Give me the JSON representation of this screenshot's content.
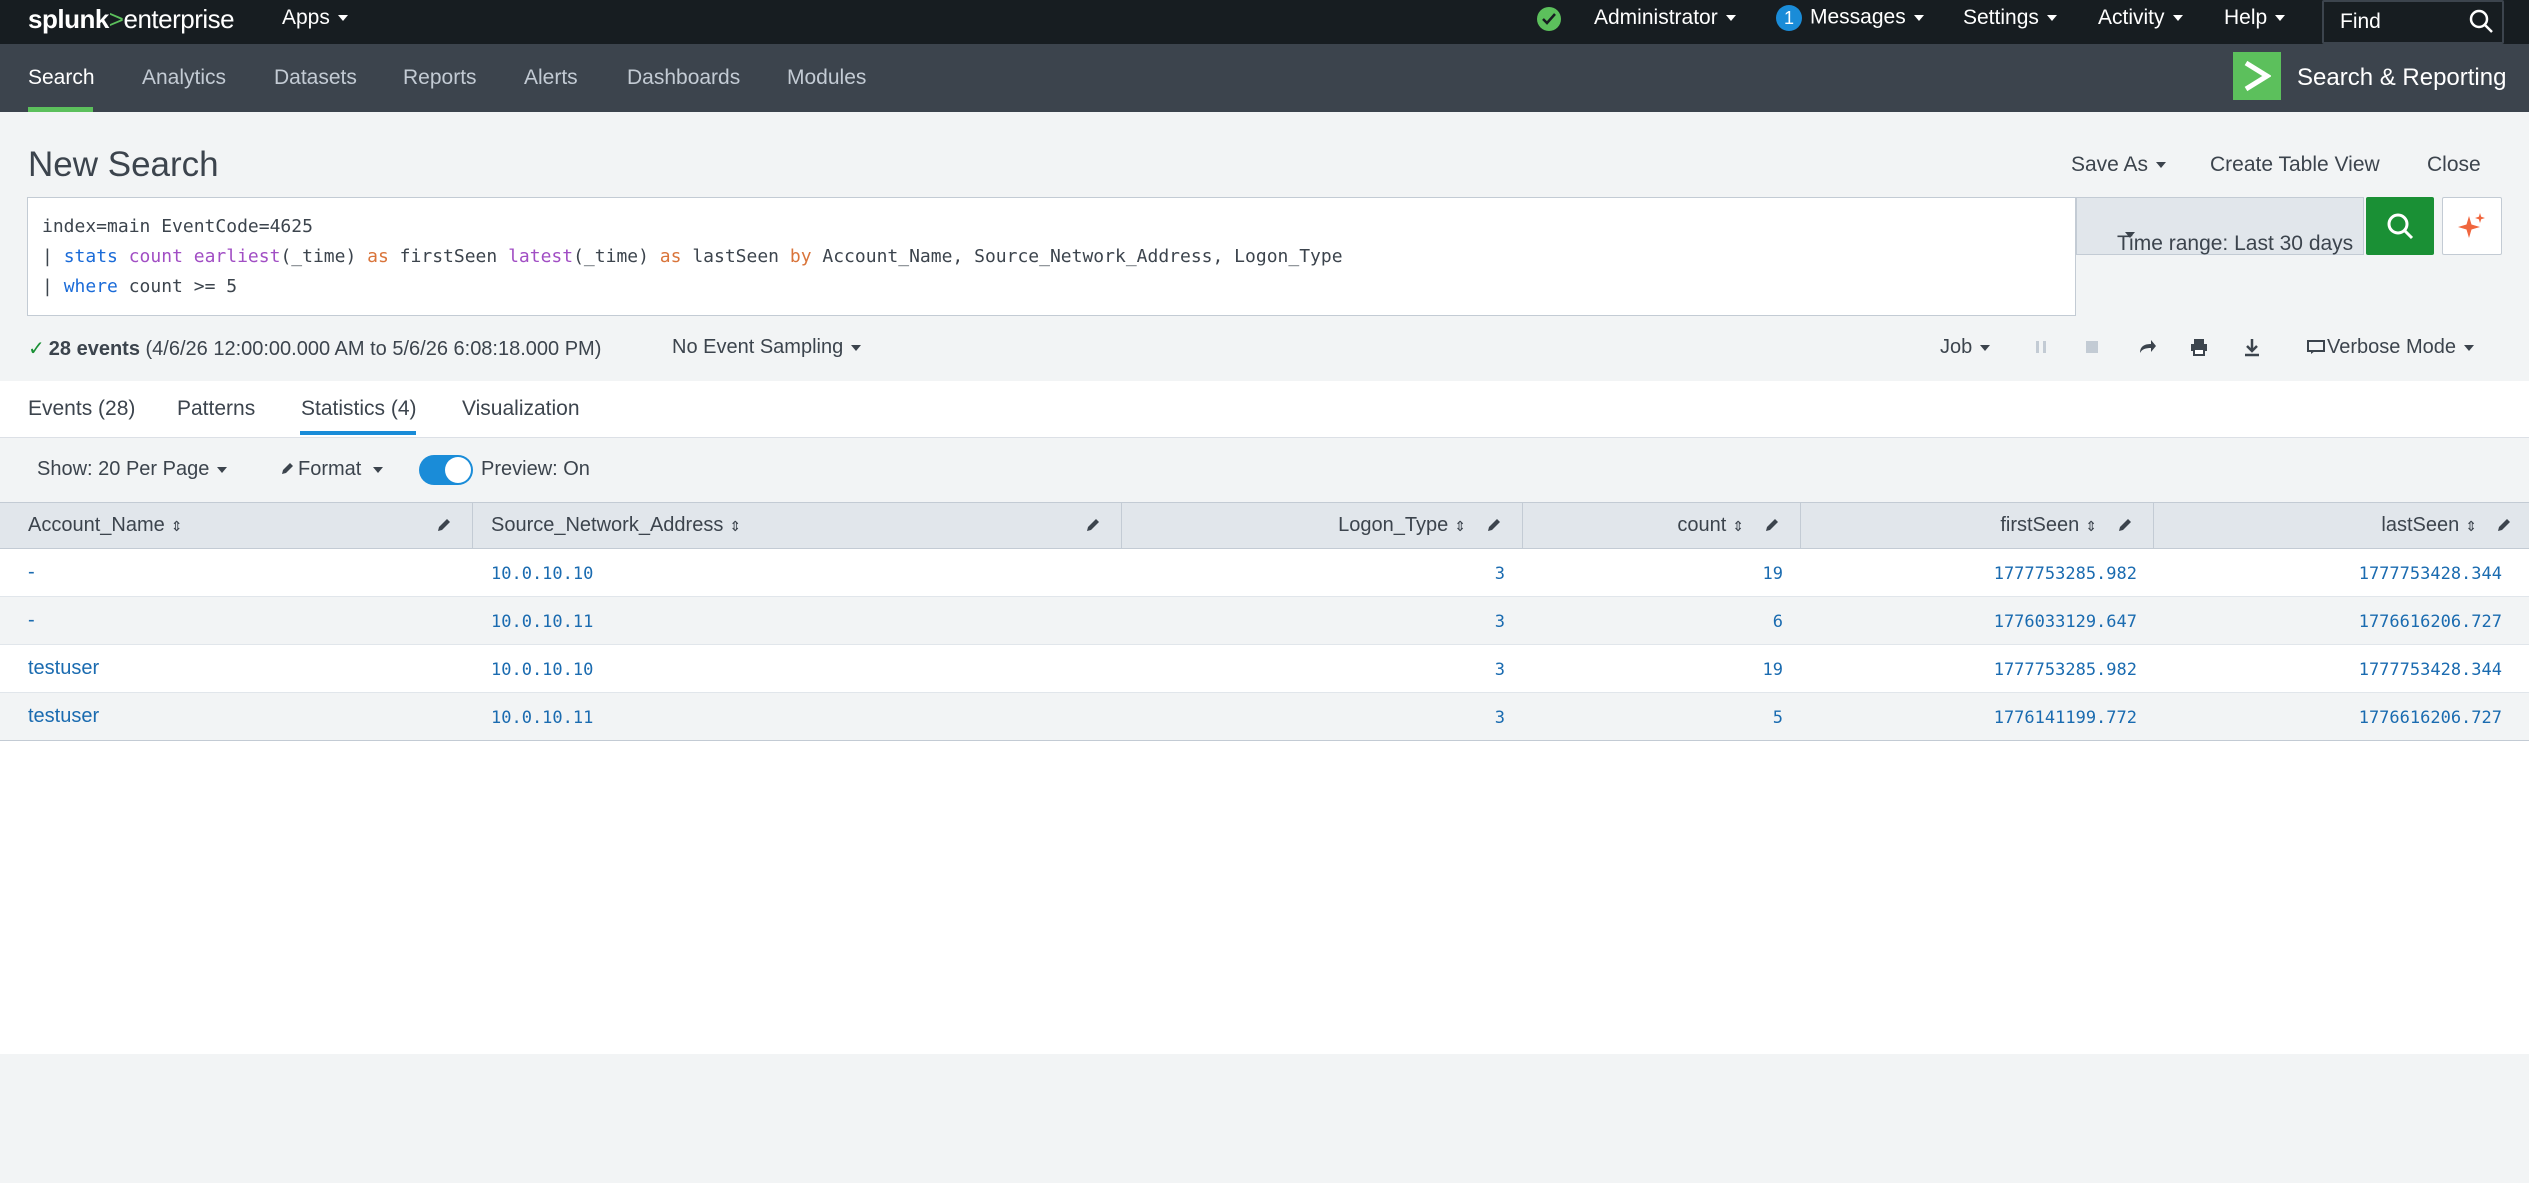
{
  "topbar": {
    "brand_main": "splunk",
    "brand_arrow": ">",
    "brand_sub": "enterprise",
    "apps_label": "Apps",
    "user_label": "Administrator",
    "messages_count": "1",
    "messages_label": "Messages",
    "settings_label": "Settings",
    "activity_label": "Activity",
    "help_label": "Help",
    "find_placeholder": "Find"
  },
  "appbar": {
    "nav": [
      "Search",
      "Analytics",
      "Datasets",
      "Reports",
      "Alerts",
      "Dashboards",
      "Modules"
    ],
    "active": "Search",
    "app_name": "Search & Reporting"
  },
  "title": {
    "page_title": "New Search",
    "save_as": "Save As",
    "create_table_view": "Create Table View",
    "close": "Close"
  },
  "search": {
    "line1": "index=main EventCode=4625",
    "line2": {
      "pipe": "| ",
      "cmd": "stats",
      "fn1": "count",
      "fn2": "earliest",
      "arg2": "(_time) ",
      "as1": "as",
      "name1": " firstSeen ",
      "fn3": "latest",
      "arg3": "(_time) ",
      "as2": "as",
      "name2": " lastSeen ",
      "by": "by",
      "fields": " Account_Name, Source_Network_Address, Logon_Type"
    },
    "line3": {
      "pipe": "| ",
      "cmd": "where",
      "rest": " count >= 5"
    },
    "time_range": "Time range: Last 30 days"
  },
  "status": {
    "events": "28 events",
    "range": "(4/6/26 12:00:00.000 AM to 5/6/26 6:08:18.000 PM)",
    "sampling": "No Event Sampling",
    "job": "Job",
    "mode": "Verbose Mode"
  },
  "tabs": [
    "Events (28)",
    "Patterns",
    "Statistics (4)",
    "Visualization"
  ],
  "active_tab": "Statistics (4)",
  "controls": {
    "show": "Show: 20 Per Page",
    "format": "Format",
    "preview": "Preview: On",
    "preview_on": true
  },
  "table": {
    "columns": [
      "Account_Name",
      "Source_Network_Address",
      "Logon_Type",
      "count",
      "firstSeen",
      "lastSeen"
    ],
    "rows": [
      [
        "-",
        "10.0.10.10",
        "3",
        "19",
        "1777753285.982",
        "1777753428.344"
      ],
      [
        "-",
        "10.0.10.11",
        "3",
        "6",
        "1776033129.647",
        "1776616206.727"
      ],
      [
        "testuser",
        "10.0.10.10",
        "3",
        "19",
        "1777753285.982",
        "1777753428.344"
      ],
      [
        "testuser",
        "10.0.10.11",
        "3",
        "5",
        "1776141199.772",
        "1776616206.727"
      ]
    ]
  },
  "colors": {
    "accent_green": "#5cc05c",
    "search_button": "#1a9035",
    "link_blue": "#1a6bb0",
    "tab_underline": "#1a8cd8"
  }
}
